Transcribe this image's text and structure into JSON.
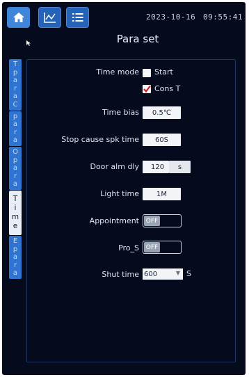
{
  "topbar": {
    "date": "2023-10-16",
    "time": "09:55:41",
    "buttons": [
      "home-icon",
      "chart-icon",
      "list-icon"
    ]
  },
  "title": "Para set",
  "side_tabs": [
    {
      "label": "TparaC",
      "chars": [
        "T",
        "p",
        "a",
        "r",
        "a",
        "C"
      ],
      "active": false
    },
    {
      "label": "para",
      "chars": [
        "p",
        "a",
        "r",
        "a"
      ],
      "active": false
    },
    {
      "label": "Opara",
      "chars": [
        "O",
        "p",
        "a",
        "r",
        "a"
      ],
      "active": false
    },
    {
      "label": "Time",
      "chars": [
        "T",
        "i",
        "m",
        "e"
      ],
      "active": true
    },
    {
      "label": "Epara",
      "chars": [
        "E",
        "p",
        "a",
        "r",
        "a"
      ],
      "active": false
    }
  ],
  "params": {
    "time_mode": {
      "label": "Time mode",
      "opt_start": "Start",
      "opt_cons": "Cons T",
      "start_checked": false,
      "cons_checked": true
    },
    "time_bias": {
      "label": "Time bias",
      "value": "0.5℃"
    },
    "stop_cause": {
      "label": "Stop cause spk time",
      "value": "60S"
    },
    "door_alm": {
      "label": "Door alm dly",
      "value": "120",
      "unit": "s"
    },
    "light_time": {
      "label": "Light time",
      "value": "1M"
    },
    "appointment": {
      "label": "Appointment",
      "state": "OFF"
    },
    "pro_s": {
      "label": "Pro_S",
      "state": "OFF"
    },
    "shut_time": {
      "label": "Shut time",
      "value": "600",
      "unit": "S"
    }
  },
  "colors": {
    "screen_bg": "#050b1c",
    "accent_blue": "#2f74d0",
    "check_red": "#d42020"
  }
}
